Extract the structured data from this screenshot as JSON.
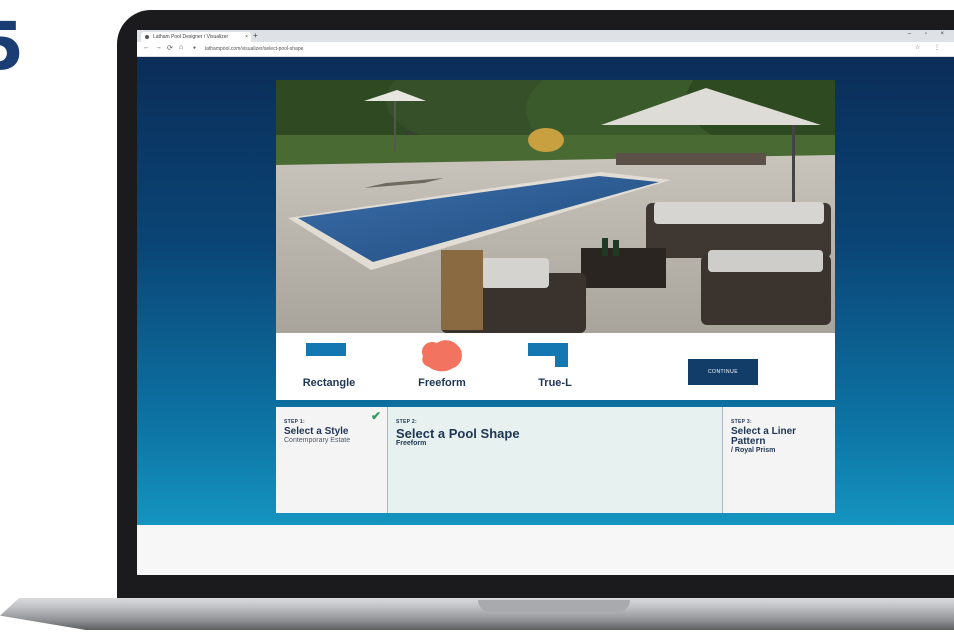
{
  "edge_digit": "5",
  "browser": {
    "tab_title": "Latham Pool Designer / Visualizer",
    "tab_close": "×",
    "new_tab": "+",
    "window_controls": "– ▫ ×",
    "nav": {
      "back": "←",
      "forward": "→",
      "reload": "⟳",
      "home": "⌂"
    },
    "url": "lathampool.com/visualizer/select-pool-shape",
    "addr_right": "☆ ⋮"
  },
  "shapes": {
    "options": [
      {
        "label": "Rectangle",
        "icon": "rectangle-shape-icon"
      },
      {
        "label": "Freeform",
        "icon": "freeform-shape-icon"
      },
      {
        "label": "True-L",
        "icon": "true-l-shape-icon"
      }
    ],
    "continue_label": "CONTINUE"
  },
  "steps": [
    {
      "num": "STEP 1:",
      "title": "Select a Style",
      "value": "Contemporary Estate",
      "completed": true,
      "check": "✔"
    },
    {
      "num": "STEP 2:",
      "title": "Select a Pool Shape",
      "value": "Freeform"
    },
    {
      "num": "STEP 3:",
      "title": "Select a Liner Pattern",
      "value": "/ Royal Prism"
    }
  ],
  "colors": {
    "page_gradient_top": "#0b2d58",
    "page_gradient_bottom": "#1594c0",
    "navy": "#123d68",
    "rectangle_icon": "#1577b2",
    "freeform_icon": "#f2735f",
    "check": "#2e9e5c"
  }
}
